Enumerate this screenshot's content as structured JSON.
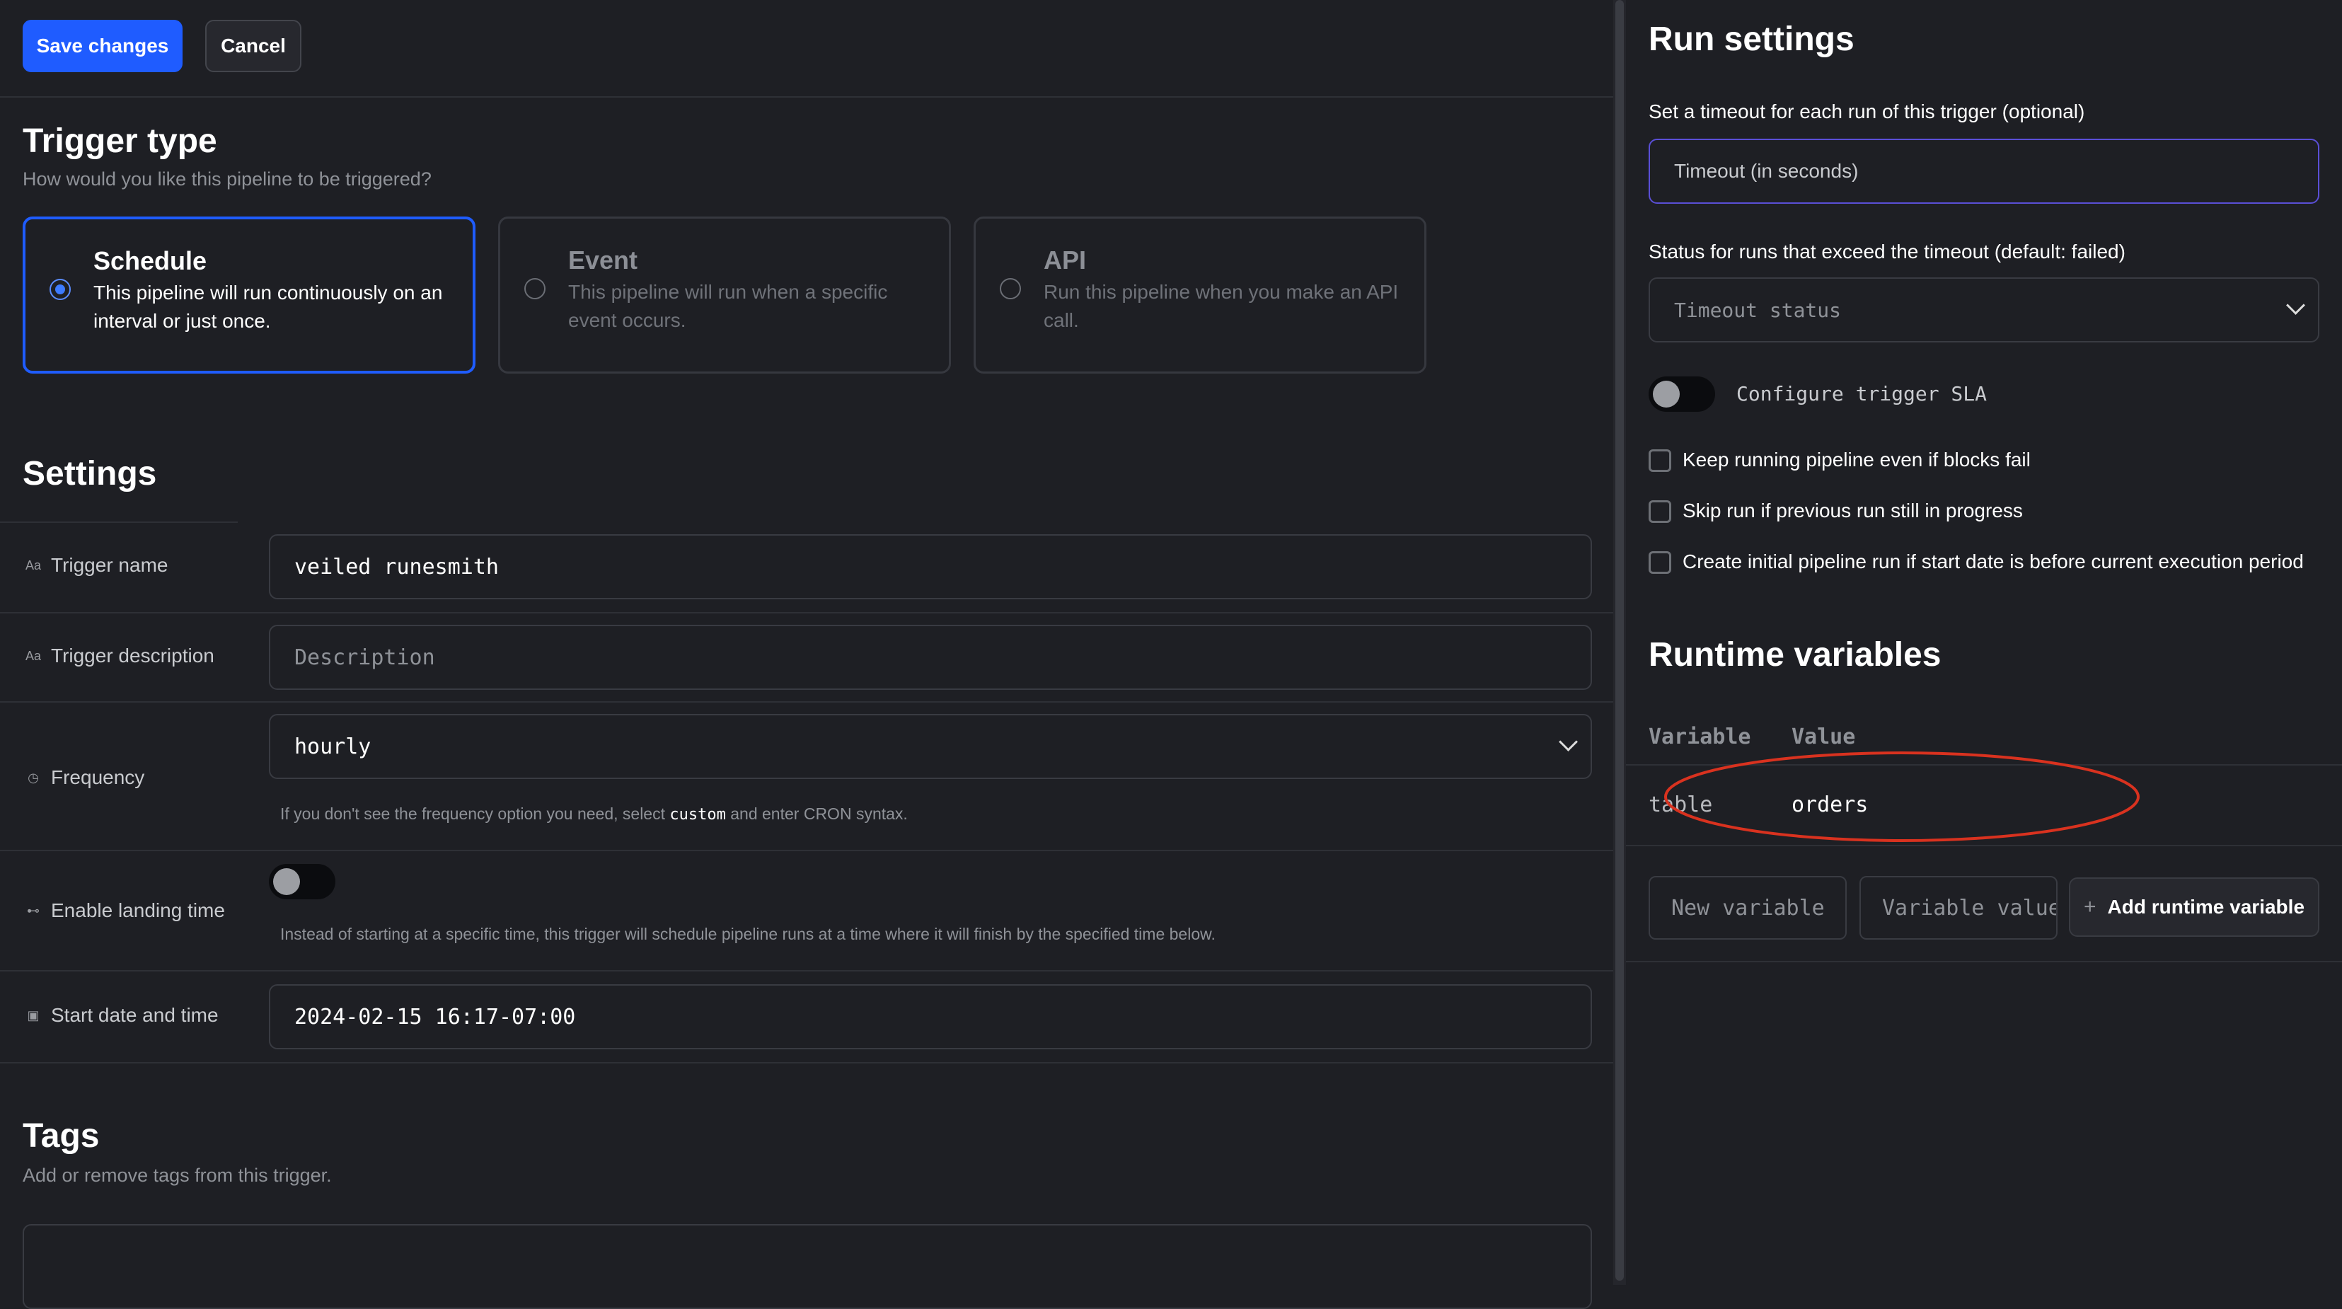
{
  "toolbar": {
    "save_label": "Save changes",
    "cancel_label": "Cancel"
  },
  "trigger_type": {
    "title": "Trigger type",
    "subtitle": "How would you like this pipeline to be triggered?",
    "options": [
      {
        "title": "Schedule",
        "description": "This pipeline will run continuously on an interval or just once.",
        "selected": true
      },
      {
        "title": "Event",
        "description": "This pipeline will run when a specific event occurs.",
        "selected": false
      },
      {
        "title": "API",
        "description": "Run this pipeline when you make an API call.",
        "selected": false
      }
    ]
  },
  "settings": {
    "title": "Settings",
    "trigger_name": {
      "label": "Trigger name",
      "value": "veiled runesmith",
      "icon": "text-type-icon"
    },
    "trigger_description": {
      "label": "Trigger description",
      "placeholder": "Description",
      "icon": "text-type-icon"
    },
    "frequency": {
      "label": "Frequency",
      "value": "hourly",
      "icon": "clock-icon",
      "hint_before": "If you don't see the frequency option you need, select ",
      "hint_code": "custom",
      "hint_after": " and enter CRON syntax."
    },
    "landing_time": {
      "label": "Enable landing time",
      "enabled": false,
      "icon": "toggle-icon",
      "hint": "Instead of starting at a specific time, this trigger will schedule pipeline runs at a time where it will finish by the specified time below."
    },
    "start_date": {
      "label": "Start date and time",
      "value": "2024-02-15 16:17-07:00",
      "icon": "calendar-icon"
    }
  },
  "tags": {
    "title": "Tags",
    "subtitle": "Add or remove tags from this trigger."
  },
  "run_settings": {
    "title": "Run settings",
    "timeout_label": "Set a timeout for each run of this trigger (optional)",
    "timeout_placeholder": "Timeout (in seconds)",
    "status_label": "Status for runs that exceed the timeout (default: failed)",
    "status_placeholder": "Timeout status",
    "sla_label": "Configure trigger SLA",
    "sla_enabled": false,
    "checkboxes": [
      {
        "label": "Keep running pipeline even if blocks fail",
        "checked": false
      },
      {
        "label": "Skip run if previous run still in progress",
        "checked": false
      },
      {
        "label": "Create initial pipeline run if start date is before current execution period",
        "checked": false
      }
    ]
  },
  "runtime_variables": {
    "title": "Runtime variables",
    "col_variable": "Variable",
    "col_value": "Value",
    "rows": [
      {
        "variable": "table",
        "value": "orders"
      }
    ],
    "new_variable_placeholder": "New variable",
    "variable_value_placeholder": "Variable value",
    "add_button_label": "Add runtime variable"
  },
  "colors": {
    "accent": "#1f5cff",
    "background": "#1e1f24",
    "annotation": "#d9321f"
  }
}
